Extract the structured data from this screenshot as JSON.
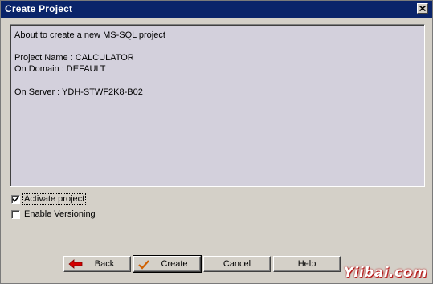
{
  "window": {
    "title": "Create Project"
  },
  "info": {
    "line1": "About to create a new MS-SQL project",
    "project_name": "Project Name : CALCULATOR",
    "domain": "On Domain : DEFAULT",
    "server_label": "On Server :",
    "server_value": "YDH-STWF2K8-B02"
  },
  "options": {
    "activate_label": "Activate project",
    "activate_checked": true,
    "versioning_label": "Enable Versioning",
    "versioning_checked": false
  },
  "buttons": {
    "back": "Back",
    "create": "Create",
    "cancel": "Cancel",
    "help": "Help"
  },
  "watermark": "Yiibai.com",
  "icons": {
    "close": "close-icon",
    "back": "red-left-arrow-icon",
    "create": "checkmark-icon"
  },
  "colors": {
    "titlebar": "#0a246a",
    "panel": "#d3d0dc",
    "dialog": "#d4d0c8"
  }
}
